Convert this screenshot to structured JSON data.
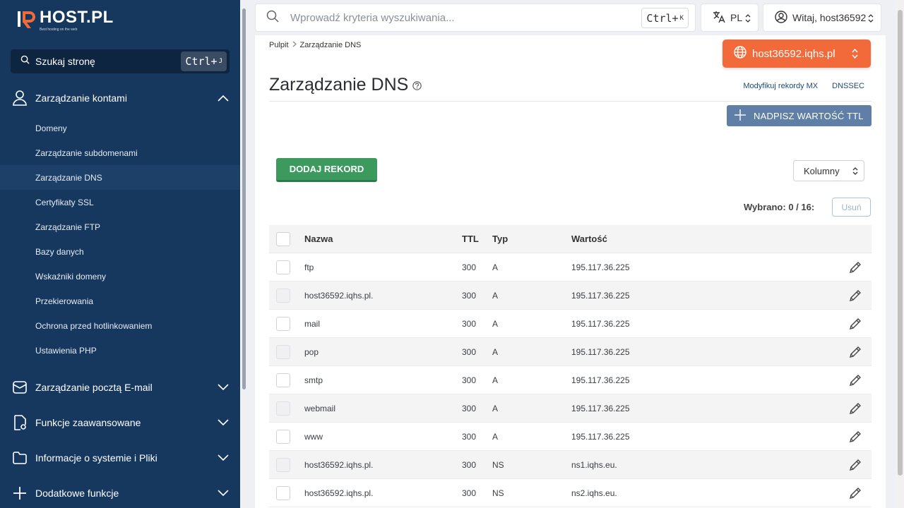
{
  "sidebar": {
    "logo_title": "HOST.PL",
    "logo_subtitle": "Best hosting on the web",
    "search_label": "Szukaj stronę",
    "search_shortcut": "Ctrl+",
    "search_shortcut_key": "J",
    "sections": [
      {
        "label": "Zarządzanie kontami",
        "icon": "user-icon",
        "expanded": true
      },
      {
        "label": "Zarządzanie pocztą E-mail",
        "icon": "mail-icon",
        "expanded": false
      },
      {
        "label": "Funkcje zaawansowane",
        "icon": "settings-doc-icon",
        "expanded": false
      },
      {
        "label": "Informacje o systemie i Pliki",
        "icon": "folder-icon",
        "expanded": false
      },
      {
        "label": "Dodatkowe funkcje",
        "icon": "plus-icon",
        "expanded": false
      }
    ],
    "sub_items": [
      {
        "label": "Domeny"
      },
      {
        "label": "Zarządzanie subdomenami"
      },
      {
        "label": "Zarządzanie DNS",
        "active": true
      },
      {
        "label": "Certyfikaty SSL"
      },
      {
        "label": "Zarządzanie FTP"
      },
      {
        "label": "Bazy danych"
      },
      {
        "label": "Wskaźniki domeny"
      },
      {
        "label": "Przekierowania"
      },
      {
        "label": "Ochrona przed hotlinkowaniem"
      },
      {
        "label": "Ustawienia PHP"
      }
    ]
  },
  "topbar": {
    "search_placeholder": "Wprowadź kryteria wyszukiwania...",
    "search_shortcut": "Ctrl+",
    "search_shortcut_key": "K",
    "language": "PL",
    "user_greeting": "Witaj, host36592"
  },
  "main": {
    "breadcrumb": [
      "Pulpit",
      "Zarządzanie DNS"
    ],
    "host_button": "host36592.iqhs.pl",
    "title": "Zarządzanie DNS",
    "links": [
      "Modyfikuj rekordy MX",
      "DNSSEC"
    ],
    "ttl_button": "NADPISZ WARTOŚĆ TTL",
    "add_button": "DODAJ REKORD",
    "columns_select": "Kolumny",
    "selected_info": "Wybrano: 0 / 16:",
    "delete_button": "Usuń",
    "table": {
      "headers": [
        "Nazwa",
        "TTL",
        "Typ",
        "Wartość"
      ],
      "rows": [
        {
          "name": "ftp",
          "ttl": "300",
          "type": "A",
          "value": "195.117.36.225"
        },
        {
          "name": "host36592.iqhs.pl.",
          "ttl": "300",
          "type": "A",
          "value": "195.117.36.225"
        },
        {
          "name": "mail",
          "ttl": "300",
          "type": "A",
          "value": "195.117.36.225"
        },
        {
          "name": "pop",
          "ttl": "300",
          "type": "A",
          "value": "195.117.36.225"
        },
        {
          "name": "smtp",
          "ttl": "300",
          "type": "A",
          "value": "195.117.36.225"
        },
        {
          "name": "webmail",
          "ttl": "300",
          "type": "A",
          "value": "195.117.36.225"
        },
        {
          "name": "www",
          "ttl": "300",
          "type": "A",
          "value": "195.117.36.225"
        },
        {
          "name": "host36592.iqhs.pl.",
          "ttl": "300",
          "type": "NS",
          "value": "ns1.iqhs.eu."
        },
        {
          "name": "host36592.iqhs.pl.",
          "ttl": "300",
          "type": "NS",
          "value": "ns2.iqhs.eu."
        }
      ]
    }
  },
  "colors": {
    "sidebar_bg": "#16385f",
    "accent_orange": "#f36a3a",
    "add_green": "#3d9a5f",
    "ttl_blue": "#5f7fa6"
  }
}
